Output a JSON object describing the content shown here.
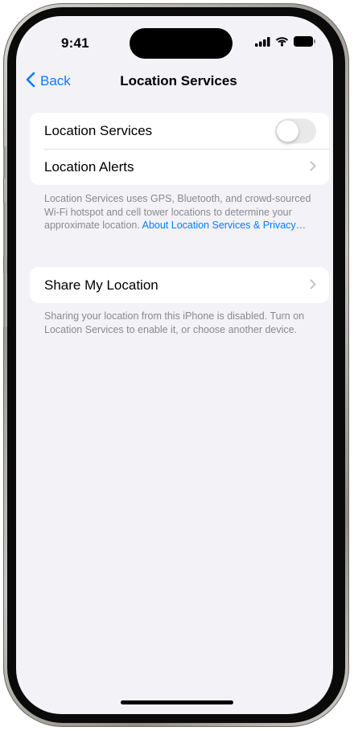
{
  "status_bar": {
    "time": "9:41",
    "icons": [
      "cellular-signal-icon",
      "wifi-icon",
      "battery-icon"
    ]
  },
  "nav": {
    "back_label": "Back",
    "title": "Location Services"
  },
  "location_group": {
    "rows": [
      {
        "label": "Location Services",
        "control": "toggle",
        "toggle_on": false
      },
      {
        "label": "Location Alerts",
        "control": "chevron"
      }
    ]
  },
  "location_footer": {
    "text": "Location Services uses GPS, Bluetooth, and crowd-sourced Wi-Fi hotspot and cell tower locations to determine your approximate location. ",
    "link": "About Location Services & Privacy…"
  },
  "share_group": {
    "rows": [
      {
        "label": "Share My Location",
        "control": "chevron"
      }
    ]
  },
  "share_footer": {
    "text": "Sharing your location from this iPhone is disabled. Turn on Location Services to enable it, or choose another device."
  },
  "colors": {
    "accent": "#0a7aff",
    "background": "#f2f2f7",
    "footer_text": "#8a8a8e",
    "toggle_off": "#e9e9ea"
  }
}
